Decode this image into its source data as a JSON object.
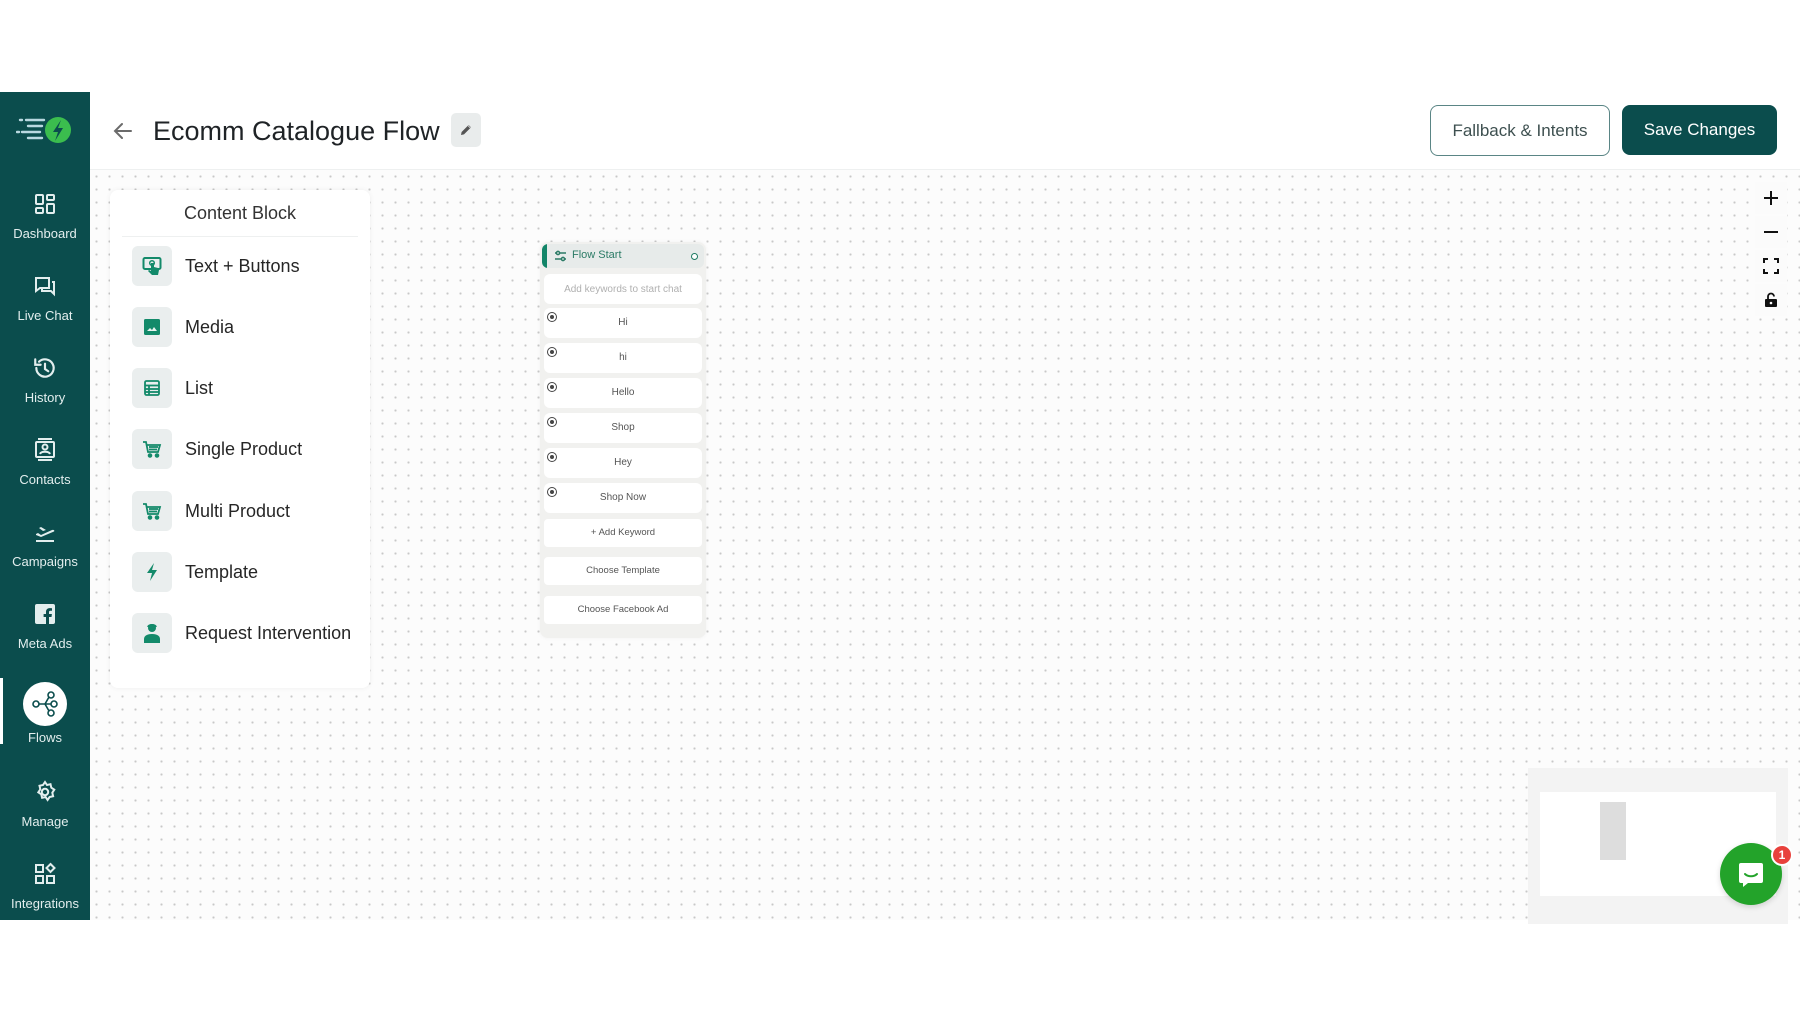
{
  "sidebar": {
    "logo": "whatsapp-automation-logo",
    "items": [
      {
        "label": "Dashboard",
        "icon": "dashboard-grid-icon",
        "active": false
      },
      {
        "label": "Live Chat",
        "icon": "chat-bubbles-icon",
        "active": false
      },
      {
        "label": "History",
        "icon": "history-clock-icon",
        "active": false
      },
      {
        "label": "Contacts",
        "icon": "contact-card-icon",
        "active": false
      },
      {
        "label": "Campaigns",
        "icon": "plane-takeoff-icon",
        "active": false
      },
      {
        "label": "Meta Ads",
        "icon": "facebook-icon",
        "active": false
      },
      {
        "label": "Flows",
        "icon": "flow-network-icon",
        "active": true
      },
      {
        "label": "Manage",
        "icon": "gear-icon",
        "active": false
      },
      {
        "label": "Integrations",
        "icon": "integrations-grid-icon",
        "active": false
      }
    ]
  },
  "header": {
    "title": "Ecomm Catalogue Flow",
    "back_icon": "arrow-left-icon",
    "edit_icon": "pencil-icon",
    "fallback_button": "Fallback & Intents",
    "save_button": "Save Changes"
  },
  "content_block": {
    "title": "Content Block",
    "items": [
      {
        "label": "Text + Buttons",
        "icon": "touch-screen-icon"
      },
      {
        "label": "Media",
        "icon": "image-icon"
      },
      {
        "label": "List",
        "icon": "list-table-icon"
      },
      {
        "label": "Single Product",
        "icon": "cart-icon"
      },
      {
        "label": "Multi Product",
        "icon": "cart-icon"
      },
      {
        "label": "Template",
        "icon": "lightning-icon"
      },
      {
        "label": "Request Intervention",
        "icon": "agent-person-icon"
      }
    ]
  },
  "flow_node": {
    "title": "Flow Start",
    "keyword_placeholder": "Add keywords to start chat",
    "keywords": [
      "Hi",
      "hi",
      "Hello",
      "Shop",
      "Hey",
      "Shop Now"
    ],
    "add_keyword": "+ Add Keyword",
    "choose_template": "Choose Template",
    "choose_facebook_ad": "Choose Facebook Ad"
  },
  "canvas_controls": {
    "zoom_in": "plus-icon",
    "zoom_out": "minus-icon",
    "fit_view": "fit-view-icon",
    "lock": "lock-icon"
  },
  "chat_widget": {
    "badge_count": "1"
  },
  "colors": {
    "brand_dark": "#0b4d4d",
    "accent_green": "#128568",
    "chat_green": "#23a32a",
    "badge_red": "#e8413c"
  }
}
